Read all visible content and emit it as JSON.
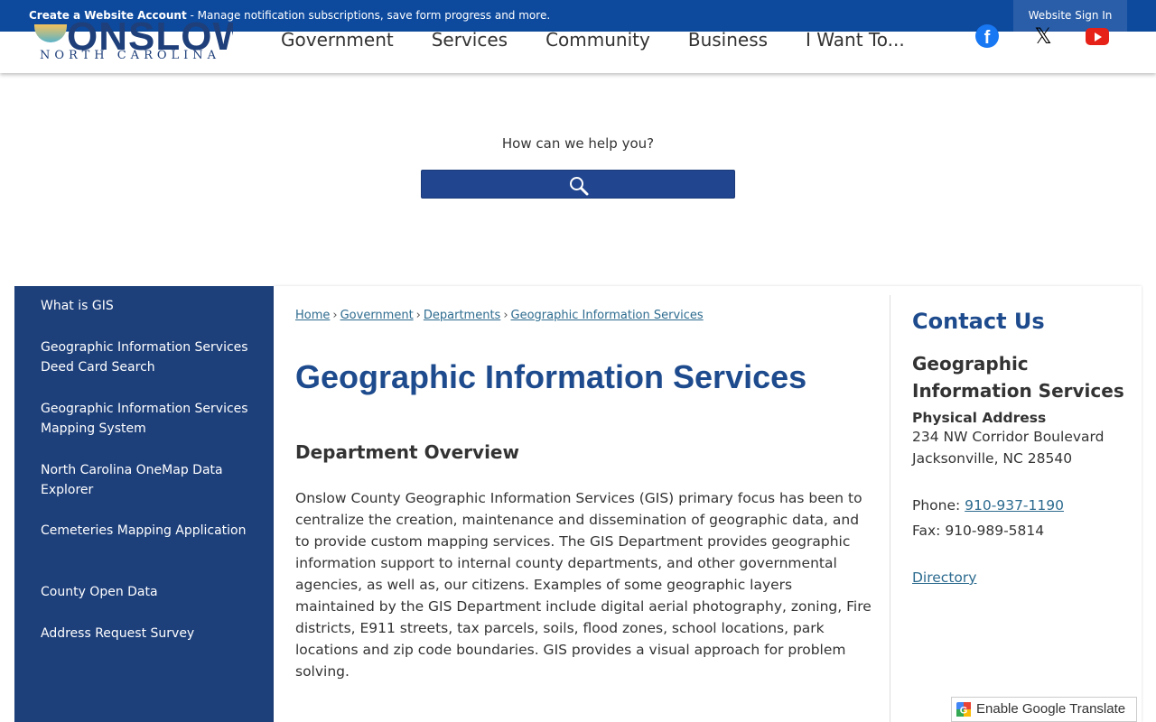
{
  "topbar": {
    "create_account_label": "Create a Website Account",
    "message": " - Manage notification subscriptions, save form progress and more.",
    "sign_in_label": "Website Sign In"
  },
  "logo": {
    "name": "ONSLOW",
    "subtitle": "NORTH CAROLINA"
  },
  "nav": {
    "items": [
      "Government",
      "Services",
      "Community",
      "Business",
      "I Want To..."
    ]
  },
  "social": {
    "icons": [
      "facebook-icon",
      "x-twitter-icon",
      "youtube-icon"
    ],
    "colors": {
      "facebook": "#1877f2",
      "youtube": "#e62117"
    }
  },
  "search": {
    "prompt": "How can we help you?",
    "icon": "search-icon"
  },
  "sidebar": {
    "items": [
      {
        "label": "What is GIS"
      },
      {
        "label": "Geographic Information Services Deed Card Search"
      },
      {
        "label": "Geographic Information Services Mapping System"
      },
      {
        "label": "North Carolina OneMap Data Explorer"
      },
      {
        "label": "Cemeteries Mapping Application"
      },
      {
        "label": "County Open Data"
      },
      {
        "label": "Address Request Survey"
      }
    ]
  },
  "breadcrumb": {
    "items": [
      "Home",
      "Government",
      "Departments",
      "Geographic Information Services"
    ],
    "separator": "›"
  },
  "main": {
    "title": "Geographic Information Services",
    "overview_heading": "Department Overview",
    "overview_text": "Onslow County Geographic Information Services (GIS) primary focus has been to centralize the creation, maintenance and dissemination of geographic data, and to provide custom mapping services. The GIS Department provides geographic information support to internal county departments, and other governmental agencies, as well as, our citizens. Examples of some geographic layers maintained by the GIS Department include digital aerial photography, zoning, Fire districts, E911 streets, tax parcels, soils, flood zones, school locations, park locations and zip code boundaries. GIS provides a visual approach for problem solving."
  },
  "contact": {
    "heading": "Contact Us",
    "department": "Geographic Information Services",
    "address_label": "Physical Address",
    "address_line1": "234 NW Corridor Boulevard",
    "address_line2": "Jacksonville, NC 28540",
    "phone_label": "Phone: ",
    "phone": "910-937-1190",
    "fax_label": "Fax: ",
    "fax": "910-989-5814",
    "directory_label": "Directory"
  },
  "translate": {
    "label": "Enable Google Translate"
  },
  "colors": {
    "brand_blue": "#1d3f7a",
    "topbar_blue": "#0d4a9e",
    "heading_blue": "#1e4b8d",
    "link_teal": "#2d6b8f"
  }
}
